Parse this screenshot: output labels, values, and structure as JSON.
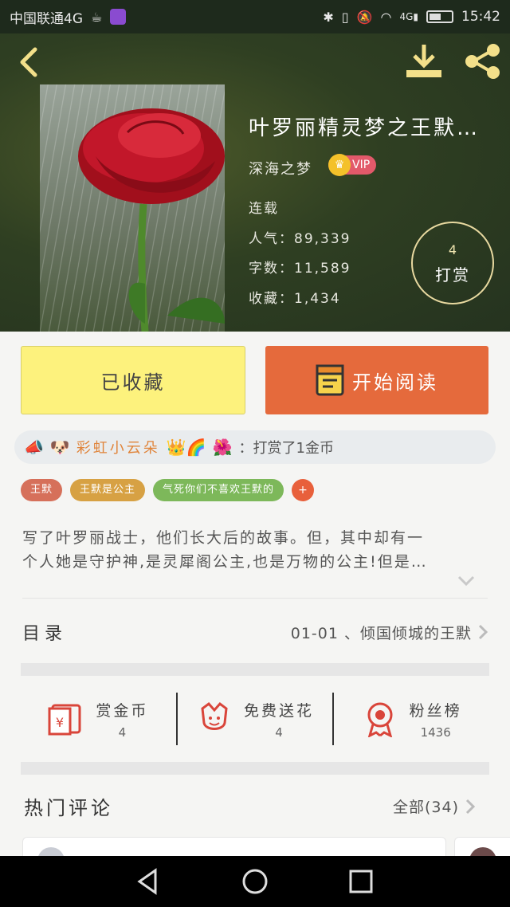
{
  "status_bar": {
    "carrier": "中国联通4G",
    "time": "15:42",
    "network": "4G"
  },
  "book": {
    "title": "叶罗丽精灵梦之王默…",
    "author": "深海之梦",
    "vip_label": "VIP",
    "serial_status": "连载",
    "popularity": "人气：89,339",
    "word_count": "字数：11,589",
    "favorites": "收藏：1,434"
  },
  "reward": {
    "count": "4",
    "label": "打赏"
  },
  "actions": {
    "collected_label": "已收藏",
    "read_label": "开始阅读"
  },
  "donation": {
    "user": "彩虹小云朵",
    "emojis": "👑🌈",
    "message": "：打赏了1金币"
  },
  "tags": [
    {
      "label": "王默",
      "color": "#d6705a"
    },
    {
      "label": "王默是公主",
      "color": "#d7a143"
    },
    {
      "label": "气死你们不喜欢王默的",
      "color": "#7db85a"
    }
  ],
  "tag_add_label": "+",
  "synopsis": {
    "line1": "写了叶罗丽战士，他们长大后的故事。但，其中却有一",
    "line2": "个人她是守护神,是灵犀阁公主,也是万物的公主!但是…"
  },
  "toc": {
    "label": "目录",
    "latest_chapter": "01-01 、倾国倾城的王默"
  },
  "stats": [
    {
      "label": "赏金币",
      "value": "4",
      "icon": "red-envelope-icon"
    },
    {
      "label": "免费送花",
      "value": "4",
      "icon": "flower-icon"
    },
    {
      "label": "粉丝榜",
      "value": "1436",
      "icon": "medal-icon"
    }
  ],
  "comments": {
    "title": "热门评论",
    "all_label": "全部(34)"
  },
  "colors": {
    "accent_orange": "#e56a3c",
    "collected_yellow": "#fdf27d",
    "icon_red": "#d9453a"
  }
}
